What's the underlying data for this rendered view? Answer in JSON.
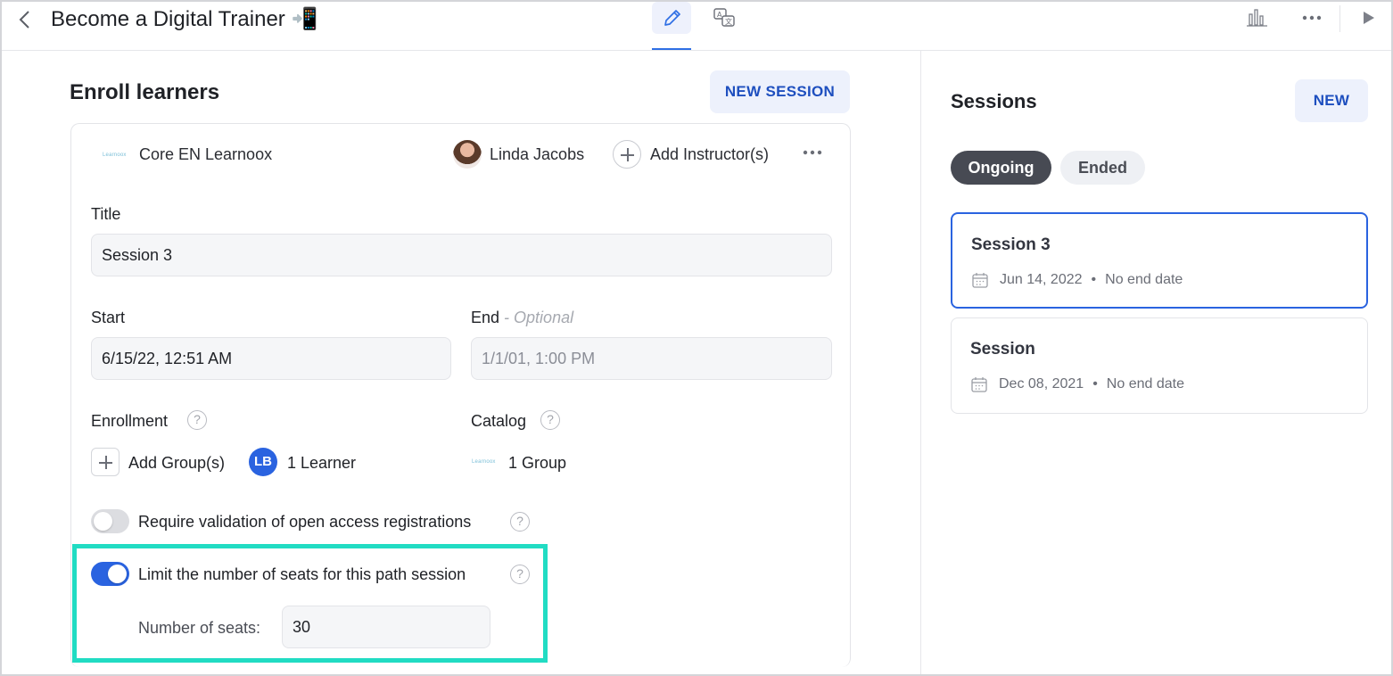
{
  "header": {
    "title": "Become a Digital Trainer",
    "title_emoji": "📲"
  },
  "enroll": {
    "heading": "Enroll learners",
    "new_session_label": "NEW SESSION",
    "catalog_logo_text": "Learnoox",
    "catalog_name": "Core EN Learnoox",
    "instructor_name": "Linda Jacobs",
    "add_instructor_label": "Add Instructor(s)",
    "title_label": "Title",
    "title_value": "Session 3",
    "start_label": "Start",
    "start_value": "6/15/22, 12:51 AM",
    "end_label": "End",
    "end_optional": "- Optional",
    "end_placeholder": "1/1/01, 1:00 PM",
    "enrollment_label": "Enrollment",
    "add_groups_label": "Add Group(s)",
    "learner_initials": "LB",
    "learners_count": "1 Learner",
    "catalog_label": "Catalog",
    "catalog_groups": "1 Group",
    "validation_label": "Require validation of open access registrations",
    "validation_enabled": false,
    "limit_seats_label": "Limit the number of seats for this path session",
    "limit_seats_enabled": true,
    "seats_label": "Number of seats:",
    "seats_value": "30",
    "help_glyph": "?"
  },
  "sessions": {
    "heading": "Sessions",
    "new_label": "NEW",
    "filters": [
      {
        "label": "Ongoing",
        "active": true
      },
      {
        "label": "Ended",
        "active": false
      }
    ],
    "items": [
      {
        "title": "Session 3",
        "date": "Jun 14, 2022",
        "end": "No end date",
        "selected": true
      },
      {
        "title": "Session",
        "date": "Dec 08, 2021",
        "end": "No end date",
        "selected": false
      }
    ],
    "separator": "•"
  },
  "colors": {
    "accent": "#2a63e0",
    "highlight": "#21dcc3",
    "soft_button_bg": "#edf1fc"
  },
  "icons": [
    "back-arrow-icon",
    "pencil-icon",
    "translate-icon",
    "bar-chart-icon",
    "more-icon",
    "play-icon",
    "calendar-icon",
    "help-icon",
    "plus-icon"
  ]
}
